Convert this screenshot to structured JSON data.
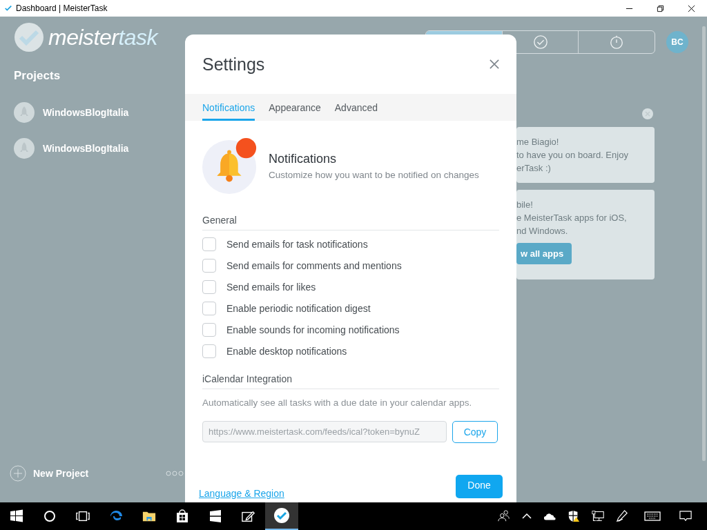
{
  "window": {
    "title": "Dashboard | MeisterTask"
  },
  "sidebar": {
    "logo_main": "meister",
    "logo_accent": "task",
    "heading": "Projects",
    "projects": [
      {
        "name": "WindowsBlogItalia"
      },
      {
        "name": "WindowsBlogItalia"
      }
    ],
    "new_project": "New Project"
  },
  "toolbar": {
    "segments": [
      {
        "kind": "highlight",
        "selected": true
      },
      {
        "kind": "check",
        "selected": false
      },
      {
        "kind": "timer",
        "selected": false
      }
    ],
    "avatar": "BC"
  },
  "cards": [
    {
      "lines": [
        "me Biagio!",
        "to have you on board. Enjoy",
        "erTask :)"
      ]
    },
    {
      "lines": [
        "bile!",
        "e MeisterTask apps for iOS,",
        "nd Windows."
      ],
      "button": "w all apps"
    }
  ],
  "settings": {
    "title": "Settings",
    "tabs": [
      {
        "label": "Notifications",
        "selected": true
      },
      {
        "label": "Appearance",
        "selected": false
      },
      {
        "label": "Advanced",
        "selected": false
      }
    ],
    "header": {
      "title": "Notifications",
      "subtitle": "Customize how you want to be notified on changes"
    },
    "general": {
      "heading": "General",
      "options": [
        {
          "label": "Send emails for task notifications",
          "checked": false
        },
        {
          "label": "Send emails for comments and mentions",
          "checked": false
        },
        {
          "label": "Send emails for likes",
          "checked": false
        },
        {
          "label": "Enable periodic notification digest",
          "checked": false
        },
        {
          "label": "Enable sounds for incoming notifications",
          "checked": false
        },
        {
          "label": "Enable desktop notifications",
          "checked": false
        }
      ]
    },
    "ical": {
      "heading": "iCalendar Integration",
      "description": "Automatically see all tasks with a due date in your calendar apps.",
      "url": "https://www.meistertask.com/feeds/ical?token=bynuZ",
      "copy": "Copy"
    },
    "footer": {
      "link": "Language & Region",
      "done": "Done"
    }
  },
  "taskbar": {
    "apps": [
      {
        "kind": "start",
        "active": false
      },
      {
        "kind": "search",
        "active": false
      },
      {
        "kind": "taskview",
        "active": false
      },
      {
        "kind": "edge",
        "active": false
      },
      {
        "kind": "explorer",
        "active": false
      },
      {
        "kind": "store",
        "active": false
      },
      {
        "kind": "tablet",
        "active": false
      },
      {
        "kind": "pen",
        "active": false
      },
      {
        "kind": "meistertask",
        "active": true
      }
    ],
    "tray": [
      {
        "kind": "people"
      },
      {
        "kind": "chevron"
      },
      {
        "kind": "cloud"
      },
      {
        "kind": "shield"
      },
      {
        "kind": "network"
      },
      {
        "kind": "ink"
      },
      {
        "kind": "keyboard"
      },
      {
        "kind": "notifications"
      }
    ]
  }
}
